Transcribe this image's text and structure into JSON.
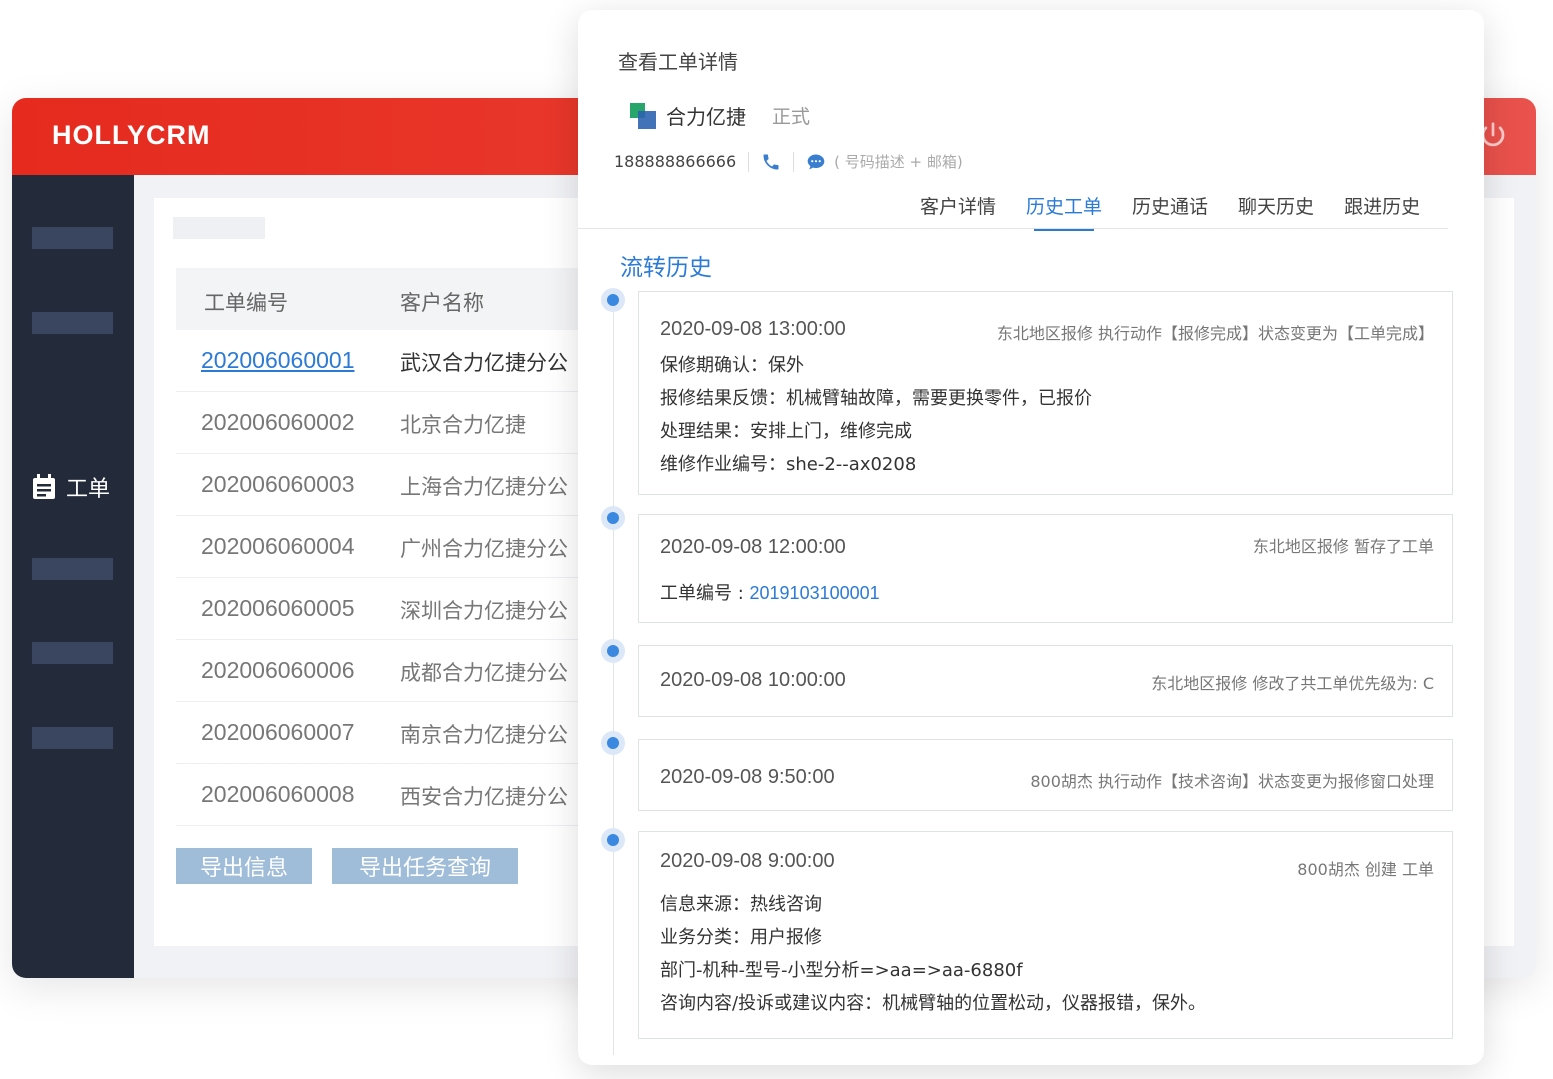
{
  "app": {
    "brand": "HOLLYCRM"
  },
  "sidebar": {
    "active_label": "工单"
  },
  "table": {
    "headers": [
      "工单编号",
      "客户名称"
    ],
    "rows": [
      {
        "id": "202006060001",
        "name": "武汉合力亿捷分公"
      },
      {
        "id": "202006060002",
        "name": "北京合力亿捷"
      },
      {
        "id": "202006060003",
        "name": "上海合力亿捷分公"
      },
      {
        "id": "202006060004",
        "name": "广州合力亿捷分公"
      },
      {
        "id": "202006060005",
        "name": "深圳合力亿捷分公"
      },
      {
        "id": "202006060006",
        "name": "成都合力亿捷分公"
      },
      {
        "id": "202006060007",
        "name": "南京合力亿捷分公"
      },
      {
        "id": "202006060008",
        "name": "西安合力亿捷分公"
      }
    ]
  },
  "buttons": {
    "export_info": "导出信息",
    "export_task": "导出任务查询"
  },
  "modal": {
    "title": "查看工单详情",
    "customer_name": "合力亿捷",
    "customer_status": "正式",
    "phone": "188888866666",
    "contact_hint": "( 号码描述 + 邮箱)",
    "tabs": [
      "客户详情",
      "历史工单",
      "历史通话",
      "聊天历史",
      "跟进历史"
    ],
    "active_tab": "历史工单",
    "section_title": "流转历史"
  },
  "timeline": [
    {
      "time": "2020-09-08 13:00:00",
      "action": "东北地区报修 执行动作【报修完成】状态变更为【工单完成】",
      "lines": [
        "保修期确认：保外",
        "报修结果反馈：机械臂轴故障，需要更换零件，已报价",
        "处理结果：安排上门，维修完成",
        "维修作业编号：she-2--ax0208"
      ]
    },
    {
      "time": "2020-09-08 12:00:00",
      "action": "东北地区报修 暂存了工单",
      "label": "工单编号 : ",
      "ticket": "2019103100001"
    },
    {
      "time": "2020-09-08 10:00:00",
      "action": "东北地区报修 修改了共工单优先级为: C"
    },
    {
      "time": "2020-09-08  9:50:00",
      "action": "800胡杰 执行动作【技术咨询】状态变更为报修窗口处理"
    },
    {
      "time": "2020-09-08  9:00:00",
      "action": "800胡杰 创建 工单",
      "lines": [
        "信息来源：热线咨询",
        "业务分类：用户报修",
        "部门-机种-型号-小型分析=>aa=>aa-6880f",
        "咨询内容/投诉或建议内容：机械臂轴的位置松动，仪器报错，保外。"
      ]
    }
  ]
}
